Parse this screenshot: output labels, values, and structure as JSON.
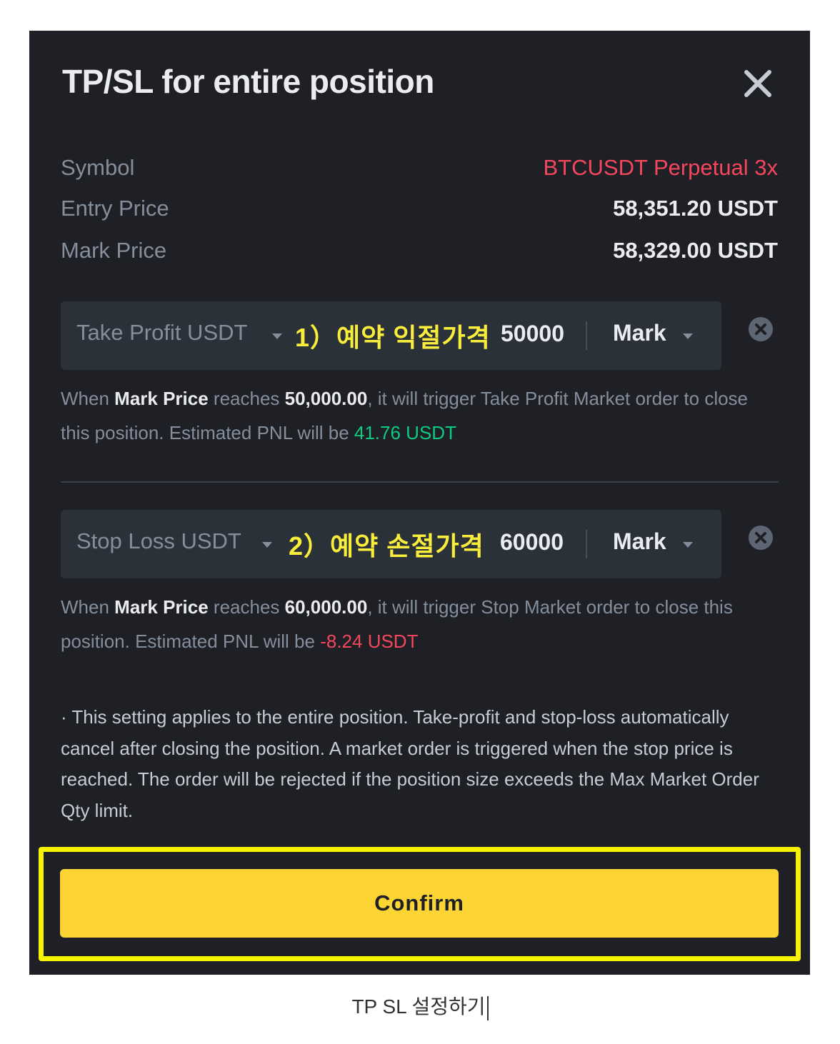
{
  "dialog": {
    "title": "TP/SL for entire position"
  },
  "info": {
    "symbol_label": "Symbol",
    "symbol_value": "BTCUSDT Perpetual 3x",
    "entry_label": "Entry Price",
    "entry_value": "58,351.20 USDT",
    "mark_label": "Mark Price",
    "mark_value": "58,329.00 USDT"
  },
  "take_profit": {
    "label": "Take Profit USDT",
    "annotation": "1）예약 익절가격",
    "value": "50000",
    "price_type": "Mark",
    "desc_prefix": "When ",
    "desc_price_name": "Mark Price",
    "desc_mid": " reaches ",
    "desc_price": "50,000.00",
    "desc_suffix": ", it will trigger Take Profit Market order to close this position. Estimated PNL will be ",
    "pnl": "41.76 USDT"
  },
  "stop_loss": {
    "label": "Stop Loss USDT",
    "annotation": "2）예약 손절가격",
    "value": "60000",
    "price_type": "Mark",
    "desc_prefix": "When ",
    "desc_price_name": "Mark Price",
    "desc_mid": " reaches ",
    "desc_price": "60,000.00",
    "desc_suffix": ", it will trigger Stop Market order to close this position. Estimated PNL will be ",
    "pnl": "-8.24 USDT"
  },
  "note": "· This setting applies to the entire position. Take-profit and stop-loss automatically cancel after closing the position. A market order is triggered when the stop price is reached. The order will be rejected if the position size exceeds the Max Market Order Qty limit.",
  "confirm_label": "Confirm",
  "caption": "TP SL 설정하기",
  "colors": {
    "background": "#1e2026",
    "input_bg": "#2b3139",
    "accent_yellow": "#fcd535",
    "highlight_border": "#f8f400",
    "profit_green": "#0ecb81",
    "loss_red": "#f6465d"
  }
}
